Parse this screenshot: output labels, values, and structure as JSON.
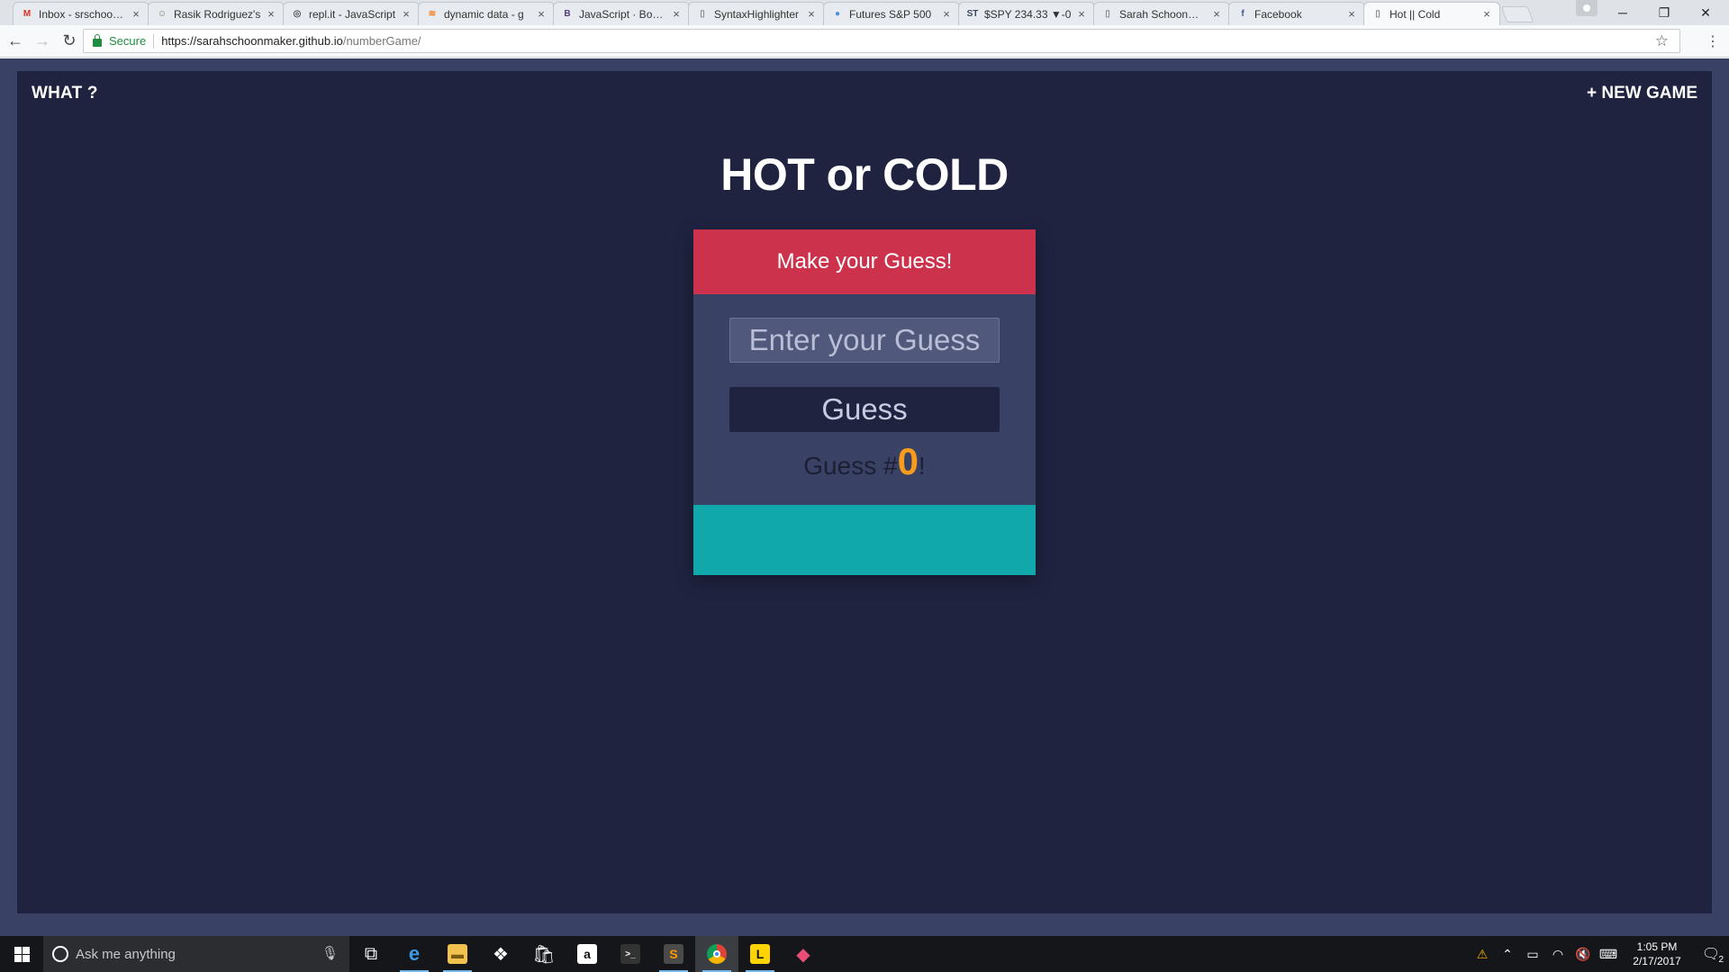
{
  "browser": {
    "tabs": [
      {
        "title": "Inbox - srschoonmaker",
        "icon": "gmail-icon",
        "color": "#d93025",
        "glyph": "M"
      },
      {
        "title": "Rasik Rodriguez's",
        "icon": "avatar-icon",
        "color": "#8a7a6a",
        "glyph": "☺"
      },
      {
        "title": "repl.it - JavaScript",
        "icon": "replit-icon",
        "color": "#555555",
        "glyph": "◎"
      },
      {
        "title": "dynamic data - g",
        "icon": "stackoverflow-icon",
        "color": "#f48024",
        "glyph": "≋"
      },
      {
        "title": "JavaScript · Bootstrap",
        "icon": "bootstrap-icon",
        "color": "#563d7c",
        "glyph": "B"
      },
      {
        "title": "SyntaxHighlighter",
        "icon": "page-icon",
        "color": "#888888",
        "glyph": "▯"
      },
      {
        "title": "Futures S&P 500",
        "icon": "globe-icon",
        "color": "#4a90d9",
        "glyph": "●"
      },
      {
        "title": "$SPY 234.33 ▼-0",
        "icon": "stocktwits-icon",
        "color": "#3b4a5c",
        "glyph": "ST"
      },
      {
        "title": "Sarah Schoonmaker",
        "icon": "page-icon",
        "color": "#888888",
        "glyph": "▯"
      },
      {
        "title": "Facebook",
        "icon": "facebook-icon",
        "color": "#3b5998",
        "glyph": "f"
      },
      {
        "title": "Hot || Cold",
        "icon": "page-icon",
        "color": "#888888",
        "glyph": "▯",
        "active": true
      }
    ],
    "security_label": "Secure",
    "url_host": "https://sarahschoonmaker.github.io",
    "url_path": "/numberGame/"
  },
  "page": {
    "nav_what": "WHAT ?",
    "nav_new_game": "+ NEW GAME",
    "title": "HOT or COLD",
    "card": {
      "heading": "Make your Guess!",
      "input_placeholder": "Enter your Guess",
      "button_label": "Guess",
      "counter_prefix": "Guess #",
      "counter_value": "0",
      "counter_suffix": "!",
      "feedback": ""
    },
    "colors": {
      "background": "#394264",
      "panel": "#1f2340",
      "heading_bar": "#cc324b",
      "feedback_bar": "#11a8ab",
      "counter_accent": "#f79c1c"
    }
  },
  "taskbar": {
    "search_placeholder": "Ask me anything",
    "apps": [
      "task-view-icon",
      "edge-icon",
      "file-explorer-icon",
      "dropbox-icon",
      "store-icon",
      "amazon-icon",
      "terminal-icon",
      "sublime-text-icon",
      "chrome-icon",
      "norton-icon",
      "gitkraken-icon"
    ],
    "time": "1:05 PM",
    "date": "2/17/2017",
    "notification_count": "2"
  }
}
